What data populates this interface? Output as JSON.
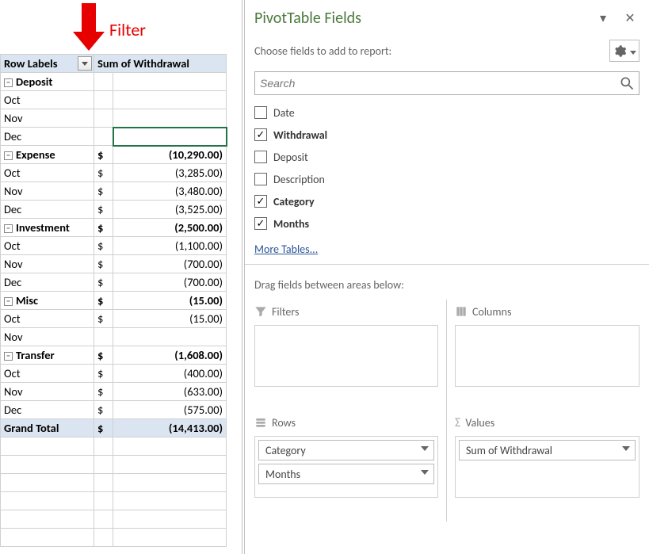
{
  "annotation": {
    "label": "Filter"
  },
  "pivot": {
    "headers": {
      "row_labels": "Row Labels",
      "sum_col": "Sum of Withdrawal"
    },
    "groups": [
      {
        "name": "Deposit",
        "cur": "",
        "total": "",
        "rows": [
          {
            "m": "Oct",
            "cur": "",
            "v": ""
          },
          {
            "m": "Nov",
            "cur": "",
            "v": ""
          },
          {
            "m": "Dec",
            "cur": "",
            "v": ""
          }
        ]
      },
      {
        "name": "Expense",
        "cur": "$",
        "total": "(10,290.00)",
        "rows": [
          {
            "m": "Oct",
            "cur": "$",
            "v": "(3,285.00)"
          },
          {
            "m": "Nov",
            "cur": "$",
            "v": "(3,480.00)"
          },
          {
            "m": "Dec",
            "cur": "$",
            "v": "(3,525.00)"
          }
        ]
      },
      {
        "name": "Investment",
        "cur": "$",
        "total": "(2,500.00)",
        "rows": [
          {
            "m": "Oct",
            "cur": "$",
            "v": "(1,100.00)"
          },
          {
            "m": "Nov",
            "cur": "$",
            "v": "(700.00)"
          },
          {
            "m": "Dec",
            "cur": "$",
            "v": "(700.00)"
          }
        ]
      },
      {
        "name": "Misc",
        "cur": "$",
        "total": "(15.00)",
        "rows": [
          {
            "m": "Oct",
            "cur": "$",
            "v": "(15.00)"
          },
          {
            "m": "Nov",
            "cur": "",
            "v": ""
          }
        ]
      },
      {
        "name": "Transfer",
        "cur": "$",
        "total": "(1,608.00)",
        "rows": [
          {
            "m": "Oct",
            "cur": "$",
            "v": "(400.00)"
          },
          {
            "m": "Nov",
            "cur": "$",
            "v": "(633.00)"
          },
          {
            "m": "Dec",
            "cur": "$",
            "v": "(575.00)"
          }
        ]
      }
    ],
    "grand": {
      "label": "Grand Total",
      "cur": "$",
      "v": "(14,413.00)"
    }
  },
  "pane": {
    "title": "PivotTable Fields",
    "choose": "Choose fields to add to report:",
    "search_placeholder": "Search",
    "fields": [
      {
        "label": "Date",
        "checked": false
      },
      {
        "label": "Withdrawal",
        "checked": true
      },
      {
        "label": "Deposit",
        "checked": false
      },
      {
        "label": "Description",
        "checked": false
      },
      {
        "label": "Category",
        "checked": true
      },
      {
        "label": "Months",
        "checked": true
      }
    ],
    "more_tables": "More Tables...",
    "drag_instr": "Drag fields between areas below:",
    "areas": {
      "filters": {
        "title": "Filters",
        "items": []
      },
      "columns": {
        "title": "Columns",
        "items": []
      },
      "rows": {
        "title": "Rows",
        "items": [
          "Category",
          "Months"
        ]
      },
      "values": {
        "title": "Values",
        "items": [
          "Sum of Withdrawal"
        ]
      }
    }
  }
}
